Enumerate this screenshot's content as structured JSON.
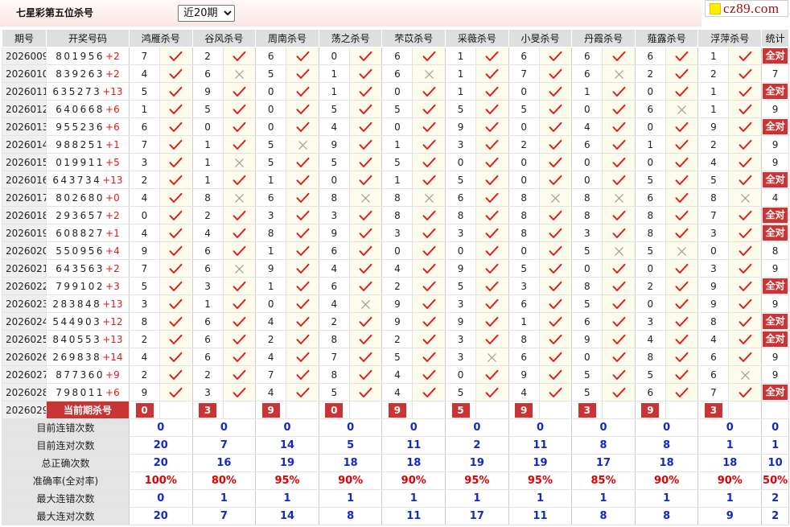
{
  "page": {
    "title": "七星彩第五位杀号",
    "period_select": {
      "selected": "近20期"
    },
    "logo_text": "cz89.com"
  },
  "colors": {
    "check": "#e01818",
    "cross": "#9a9a9a",
    "badge_bg": "#c93434",
    "summary_value": "#1428c8",
    "accuracy_value": "#e00000"
  },
  "table": {
    "headers": {
      "issue": "期号",
      "draw": "开奖号码",
      "experts": [
        "鸿雁杀号",
        "谷风杀号",
        "周南杀号",
        "荡之杀号",
        "芣苡杀号",
        "采薇杀号",
        "小旻杀号",
        "丹霞杀号",
        "薤露杀号",
        "浮萍杀号"
      ],
      "stat": "统计"
    },
    "rows": [
      {
        "issue": "2026009",
        "draw": "801956",
        "bonus": "+2",
        "picks": [
          "7",
          "2",
          "6",
          "0",
          "6",
          "1",
          "6",
          "6",
          "6",
          "1"
        ],
        "hits": [
          1,
          1,
          1,
          1,
          1,
          1,
          1,
          1,
          1,
          1
        ],
        "stat": "全对"
      },
      {
        "issue": "2026010",
        "draw": "839263",
        "bonus": "+2",
        "picks": [
          "4",
          "6",
          "5",
          "1",
          "6",
          "1",
          "7",
          "6",
          "2",
          "2"
        ],
        "hits": [
          1,
          0,
          1,
          1,
          0,
          1,
          1,
          0,
          1,
          1
        ],
        "stat": "7"
      },
      {
        "issue": "2026011",
        "draw": "635273",
        "bonus": "+13",
        "picks": [
          "5",
          "9",
          "0",
          "1",
          "0",
          "1",
          "0",
          "1",
          "0",
          "1"
        ],
        "hits": [
          1,
          1,
          1,
          1,
          1,
          1,
          1,
          1,
          1,
          1
        ],
        "stat": "全对"
      },
      {
        "issue": "2026012",
        "draw": "640668",
        "bonus": "+6",
        "picks": [
          "1",
          "5",
          "0",
          "5",
          "5",
          "5",
          "5",
          "0",
          "6",
          "1"
        ],
        "hits": [
          1,
          1,
          1,
          1,
          1,
          1,
          1,
          1,
          0,
          1
        ],
        "stat": "9"
      },
      {
        "issue": "2026013",
        "draw": "955236",
        "bonus": "+6",
        "picks": [
          "6",
          "0",
          "0",
          "4",
          "0",
          "9",
          "0",
          "4",
          "0",
          "9"
        ],
        "hits": [
          1,
          1,
          1,
          1,
          1,
          1,
          1,
          1,
          1,
          1
        ],
        "stat": "全对"
      },
      {
        "issue": "2026014",
        "draw": "988251",
        "bonus": "+1",
        "picks": [
          "7",
          "1",
          "5",
          "9",
          "1",
          "3",
          "2",
          "6",
          "1",
          "2"
        ],
        "hits": [
          1,
          1,
          0,
          1,
          1,
          1,
          1,
          1,
          1,
          1
        ],
        "stat": "9"
      },
      {
        "issue": "2026015",
        "draw": "019911",
        "bonus": "+5",
        "picks": [
          "3",
          "1",
          "5",
          "5",
          "5",
          "0",
          "0",
          "0",
          "0",
          "4"
        ],
        "hits": [
          1,
          0,
          1,
          1,
          1,
          1,
          1,
          1,
          1,
          1
        ],
        "stat": "9"
      },
      {
        "issue": "2026016",
        "draw": "643734",
        "bonus": "+13",
        "picks": [
          "2",
          "1",
          "1",
          "0",
          "1",
          "5",
          "0",
          "0",
          "5",
          "5"
        ],
        "hits": [
          1,
          1,
          1,
          1,
          1,
          1,
          1,
          1,
          1,
          1
        ],
        "stat": "全对"
      },
      {
        "issue": "2026017",
        "draw": "802680",
        "bonus": "+0",
        "picks": [
          "4",
          "8",
          "6",
          "8",
          "8",
          "6",
          "8",
          "8",
          "6",
          "8"
        ],
        "hits": [
          1,
          0,
          1,
          0,
          0,
          1,
          0,
          0,
          1,
          0
        ],
        "stat": "4"
      },
      {
        "issue": "2026018",
        "draw": "293657",
        "bonus": "+2",
        "picks": [
          "0",
          "2",
          "3",
          "3",
          "8",
          "8",
          "8",
          "8",
          "8",
          "7"
        ],
        "hits": [
          1,
          1,
          1,
          1,
          1,
          1,
          1,
          1,
          1,
          1
        ],
        "stat": "全对"
      },
      {
        "issue": "2026019",
        "draw": "608827",
        "bonus": "+1",
        "picks": [
          "4",
          "4",
          "8",
          "9",
          "3",
          "3",
          "8",
          "3",
          "8",
          "3"
        ],
        "hits": [
          1,
          1,
          1,
          1,
          1,
          1,
          1,
          1,
          1,
          1
        ],
        "stat": "全对"
      },
      {
        "issue": "2026020",
        "draw": "550956",
        "bonus": "+4",
        "picks": [
          "9",
          "6",
          "1",
          "6",
          "0",
          "0",
          "0",
          "5",
          "5",
          "0"
        ],
        "hits": [
          1,
          1,
          1,
          1,
          1,
          1,
          1,
          0,
          0,
          1
        ],
        "stat": "8"
      },
      {
        "issue": "2026021",
        "draw": "643563",
        "bonus": "+2",
        "picks": [
          "7",
          "6",
          "9",
          "4",
          "4",
          "9",
          "5",
          "0",
          "0",
          "3"
        ],
        "hits": [
          1,
          0,
          1,
          1,
          1,
          1,
          1,
          1,
          1,
          1
        ],
        "stat": "9"
      },
      {
        "issue": "2026022",
        "draw": "799102",
        "bonus": "+3",
        "picks": [
          "5",
          "3",
          "1",
          "6",
          "2",
          "5",
          "3",
          "8",
          "2",
          "9"
        ],
        "hits": [
          1,
          1,
          1,
          1,
          1,
          1,
          1,
          1,
          1,
          1
        ],
        "stat": "全对"
      },
      {
        "issue": "2026023",
        "draw": "283848",
        "bonus": "+13",
        "picks": [
          "3",
          "1",
          "0",
          "4",
          "9",
          "3",
          "6",
          "5",
          "0",
          "9"
        ],
        "hits": [
          1,
          1,
          1,
          0,
          1,
          1,
          1,
          1,
          1,
          1
        ],
        "stat": "9"
      },
      {
        "issue": "2026024",
        "draw": "544903",
        "bonus": "+12",
        "picks": [
          "8",
          "6",
          "4",
          "2",
          "9",
          "9",
          "1",
          "6",
          "3",
          "8"
        ],
        "hits": [
          1,
          1,
          1,
          1,
          1,
          1,
          1,
          1,
          1,
          1
        ],
        "stat": "全对"
      },
      {
        "issue": "2026025",
        "draw": "840553",
        "bonus": "+13",
        "picks": [
          "2",
          "6",
          "2",
          "8",
          "2",
          "3",
          "8",
          "9",
          "4",
          "4"
        ],
        "hits": [
          1,
          1,
          1,
          1,
          1,
          1,
          1,
          1,
          1,
          1
        ],
        "stat": "全对"
      },
      {
        "issue": "2026026",
        "draw": "269838",
        "bonus": "+14",
        "picks": [
          "4",
          "6",
          "4",
          "7",
          "5",
          "3",
          "6",
          "0",
          "8",
          "6"
        ],
        "hits": [
          1,
          1,
          1,
          1,
          1,
          0,
          1,
          1,
          1,
          1
        ],
        "stat": "9"
      },
      {
        "issue": "2026027",
        "draw": "877360",
        "bonus": "+9",
        "picks": [
          "2",
          "2",
          "7",
          "8",
          "4",
          "0",
          "9",
          "5",
          "5",
          "6"
        ],
        "hits": [
          1,
          1,
          1,
          1,
          1,
          1,
          1,
          1,
          1,
          0
        ],
        "stat": "9"
      },
      {
        "issue": "2026028",
        "draw": "798011",
        "bonus": "+6",
        "picks": [
          "9",
          "3",
          "4",
          "5",
          "4",
          "5",
          "4",
          "5",
          "6",
          "7"
        ],
        "hits": [
          1,
          1,
          1,
          1,
          1,
          1,
          1,
          1,
          1,
          1
        ],
        "stat": "全对"
      }
    ],
    "current": {
      "issue": "2026029",
      "label": "当前期杀号",
      "picks": [
        "0",
        "3",
        "9",
        "0",
        "9",
        "5",
        "9",
        "3",
        "9",
        "3"
      ]
    },
    "summary": [
      {
        "label": "目前连错次数",
        "values": [
          "0",
          "0",
          "0",
          "0",
          "0",
          "0",
          "0",
          "0",
          "0",
          "0"
        ],
        "total": "0",
        "color": "#1428c8"
      },
      {
        "label": "目前连对次数",
        "values": [
          "20",
          "7",
          "14",
          "5",
          "11",
          "2",
          "11",
          "8",
          "8",
          "1"
        ],
        "total": "1",
        "color": "#1428c8"
      },
      {
        "label": "总正确次数",
        "values": [
          "20",
          "16",
          "19",
          "18",
          "18",
          "19",
          "19",
          "17",
          "18",
          "18"
        ],
        "total": "10",
        "color": "#1428c8"
      },
      {
        "label": "准确率(全对率)",
        "values": [
          "100%",
          "80%",
          "95%",
          "90%",
          "90%",
          "95%",
          "95%",
          "85%",
          "90%",
          "90%"
        ],
        "total": "50%",
        "color": "#e00000"
      },
      {
        "label": "最大连错次数",
        "values": [
          "0",
          "1",
          "1",
          "1",
          "1",
          "1",
          "1",
          "1",
          "1",
          "1"
        ],
        "total": "2",
        "color": "#1428c8"
      },
      {
        "label": "最大连对次数",
        "values": [
          "20",
          "7",
          "14",
          "8",
          "11",
          "17",
          "11",
          "8",
          "8",
          "9"
        ],
        "total": "2",
        "color": "#1428c8"
      }
    ]
  }
}
